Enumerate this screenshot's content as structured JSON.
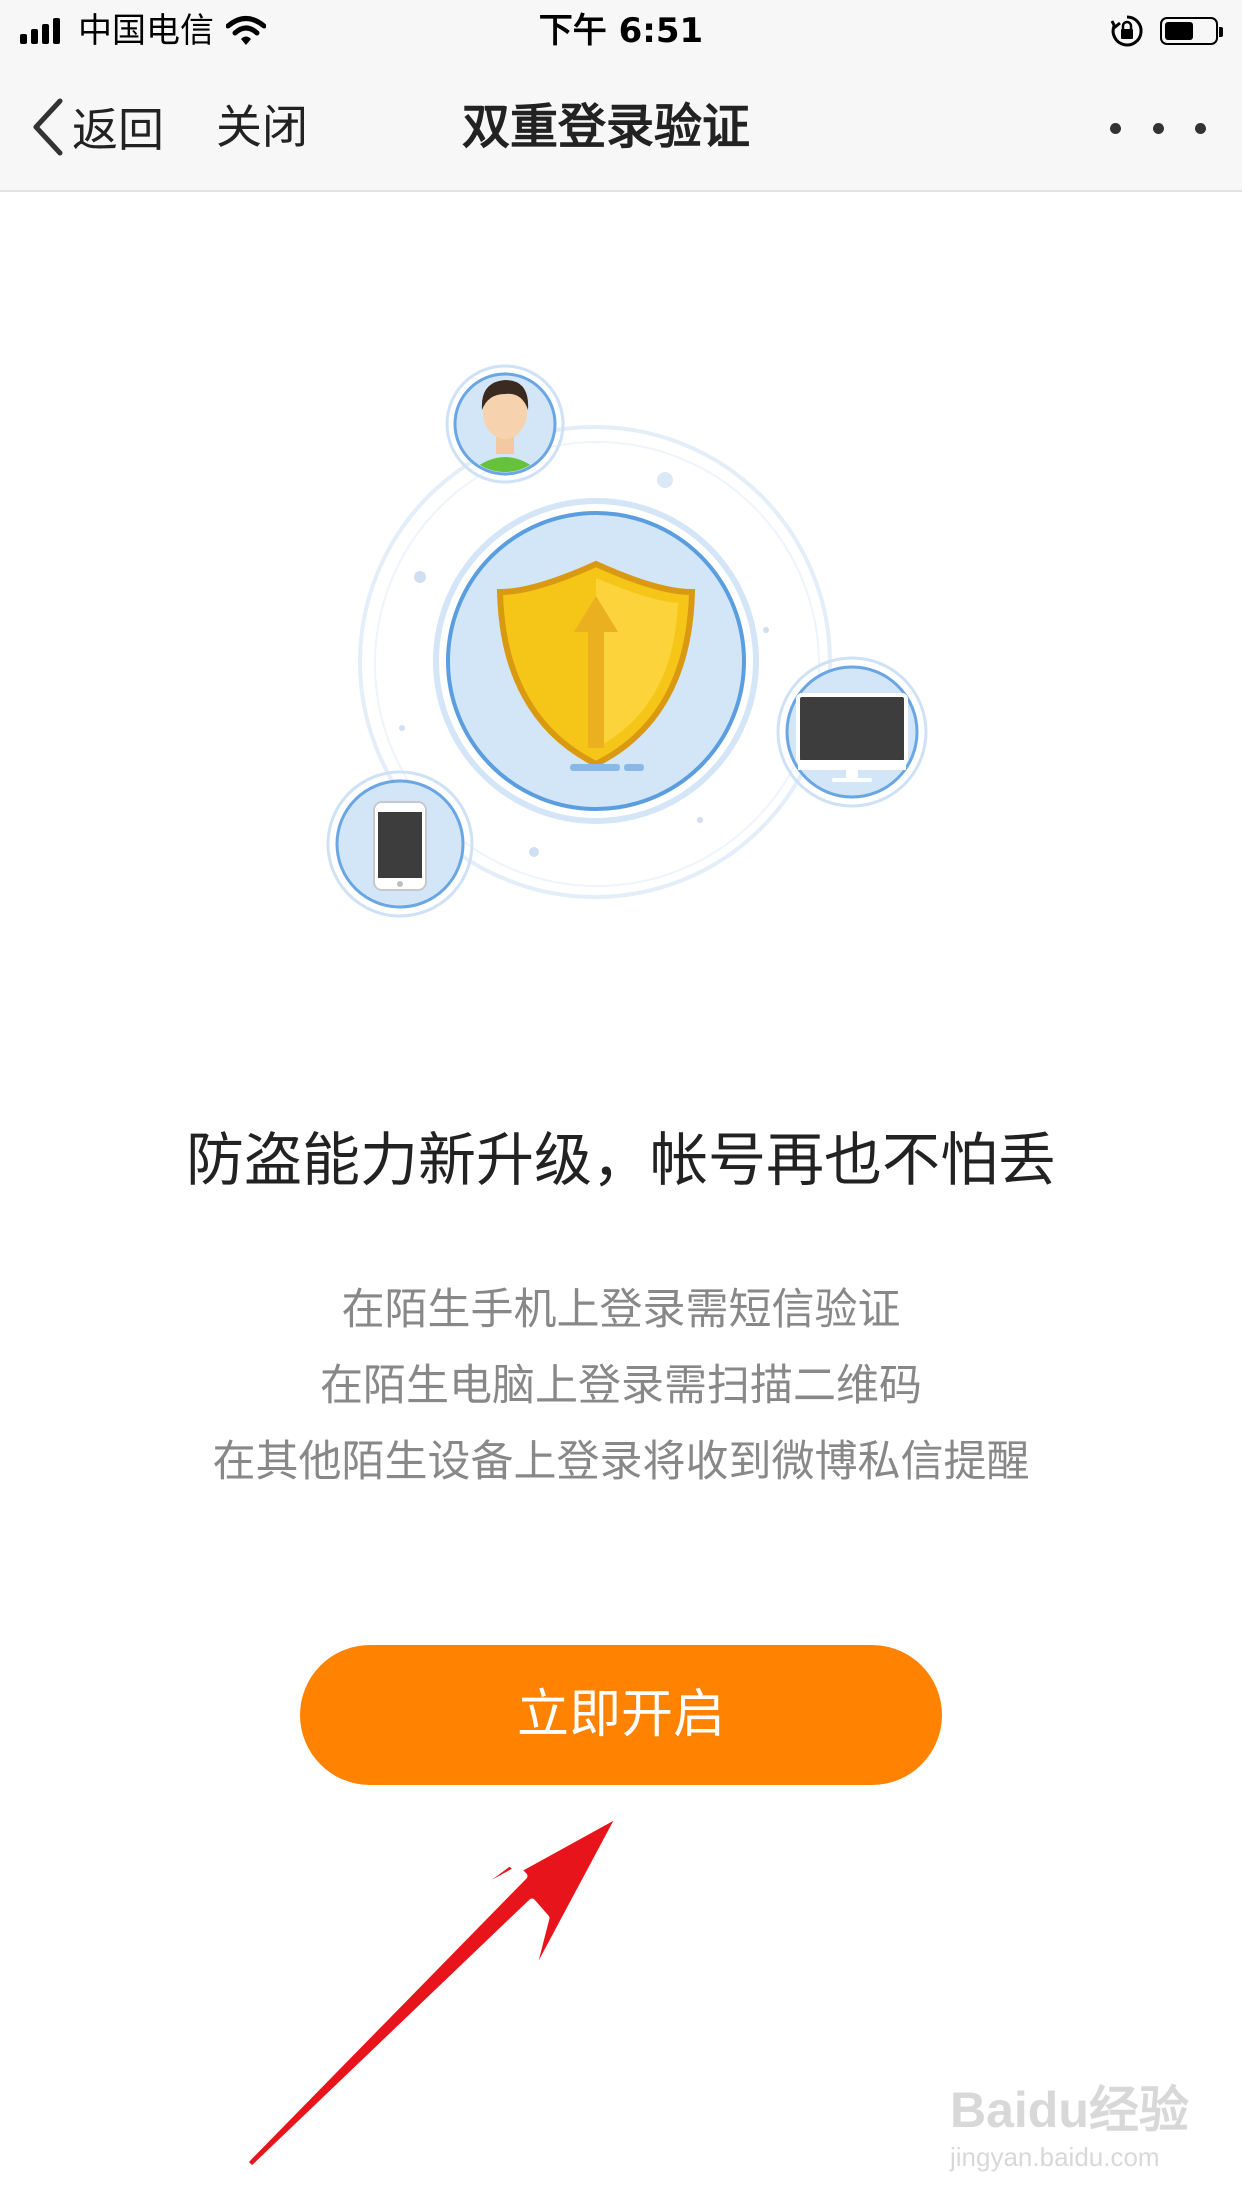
{
  "status_bar": {
    "carrier": "中国电信",
    "time": "下午 6:51"
  },
  "nav": {
    "back_label": "返回",
    "close_label": "关闭",
    "title": "双重登录验证"
  },
  "content": {
    "headline": "防盗能力新升级，帐号再也不怕丢",
    "descriptions": [
      "在陌生手机上登录需短信验证",
      "在陌生电脑上登录需扫描二维码",
      "在其他陌生设备上登录将收到微博私信提醒"
    ],
    "enable_button": "立即开启"
  },
  "watermark": {
    "brand": "Baidu经验",
    "url": "jingyan.baidu.com"
  },
  "colors": {
    "accent": "#ff8200",
    "annotation_arrow": "#e8141b",
    "illustration_blue": "#cfe3f7",
    "shield_yellow": "#f5c518"
  },
  "icons": [
    "signal-icon",
    "wifi-icon",
    "rotation-lock-icon",
    "battery-icon",
    "chevron-left-icon",
    "more-icon",
    "user-avatar-icon",
    "shield-icon",
    "desktop-monitor-icon",
    "smartphone-icon",
    "arrow-annotation"
  ]
}
